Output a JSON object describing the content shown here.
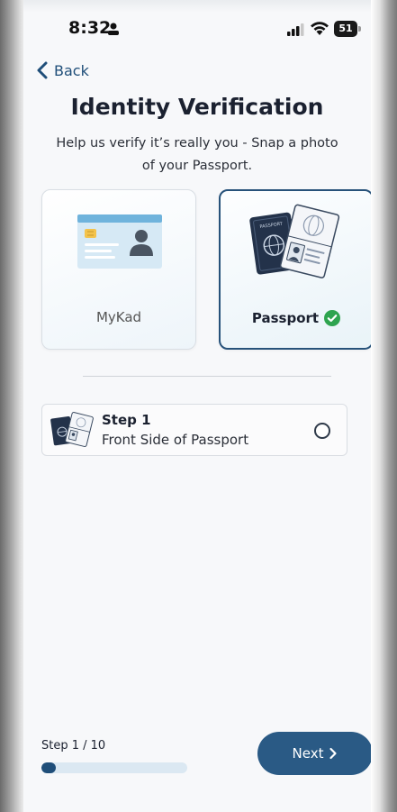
{
  "status_bar": {
    "time": "8:32",
    "battery": "51"
  },
  "nav": {
    "back_label": "Back"
  },
  "header": {
    "title": "Identity Verification",
    "subtitle": "Help us verify it’s really you - Snap a photo of your Passport."
  },
  "document_options": [
    {
      "label": "MyKad",
      "selected": false,
      "icon": "id-card-icon"
    },
    {
      "label": "Passport",
      "selected": true,
      "icon": "passport-icon"
    }
  ],
  "steps": [
    {
      "title": "Step 1",
      "description": "Front Side of Passport",
      "completed": false
    }
  ],
  "footer": {
    "progress_label": "Step 1 / 10",
    "progress_fraction": 0.1,
    "next_label": "Next"
  },
  "colors": {
    "primary": "#2a5a85",
    "accent_dark": "#1f4e79",
    "success": "#2ea44f",
    "track": "#dbe8f2"
  }
}
